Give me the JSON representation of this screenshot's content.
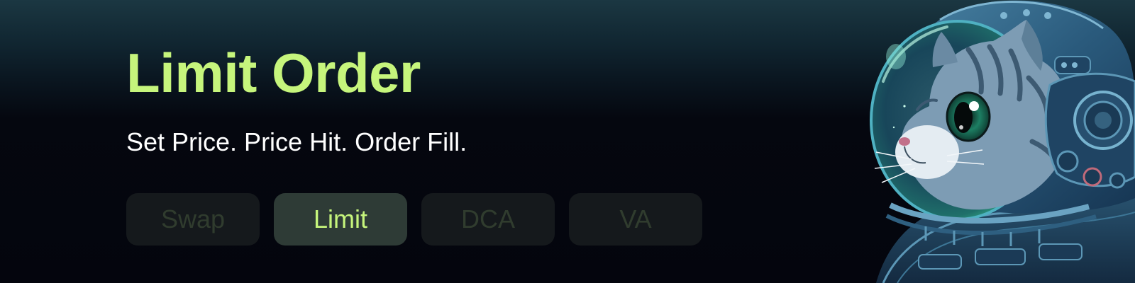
{
  "hero": {
    "title": "Limit Order",
    "subtitle": "Set Price. Price Hit. Order Fill."
  },
  "tabs": [
    {
      "label": "Swap",
      "active": false
    },
    {
      "label": "Limit",
      "active": true
    },
    {
      "label": "DCA",
      "active": false
    },
    {
      "label": "VA",
      "active": false
    }
  ],
  "illustration": {
    "icon": "astronaut-cat-icon"
  },
  "colors": {
    "accent": "#c6f57c",
    "background": "#05070f",
    "tab_inactive_bg": "#15191c",
    "tab_active_bg": "#2e3b36",
    "tab_inactive_text": "#303c2e"
  }
}
